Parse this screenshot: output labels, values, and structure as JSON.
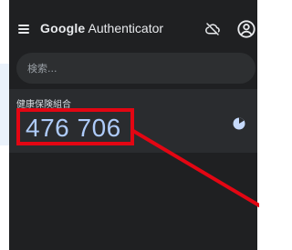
{
  "app": {
    "title_brand": "Google",
    "title_rest": "Authenticator"
  },
  "icons": {
    "menu": "menu-icon",
    "cloud_off": "cloud-off-icon",
    "account": "account-icon",
    "timer": "timer-icon"
  },
  "search": {
    "placeholder": "検索..."
  },
  "entries": [
    {
      "label": "健康保険組合",
      "code": "476 706"
    }
  ],
  "colors": {
    "app_bg": "#1f2022",
    "search_bg": "#2d2f31",
    "entry_bg": "#2a2c2f",
    "code_text": "#aecbfa",
    "highlight_red": "#e30613",
    "icon_light": "#e8eaed",
    "timer_blue": "#c6dafc"
  }
}
